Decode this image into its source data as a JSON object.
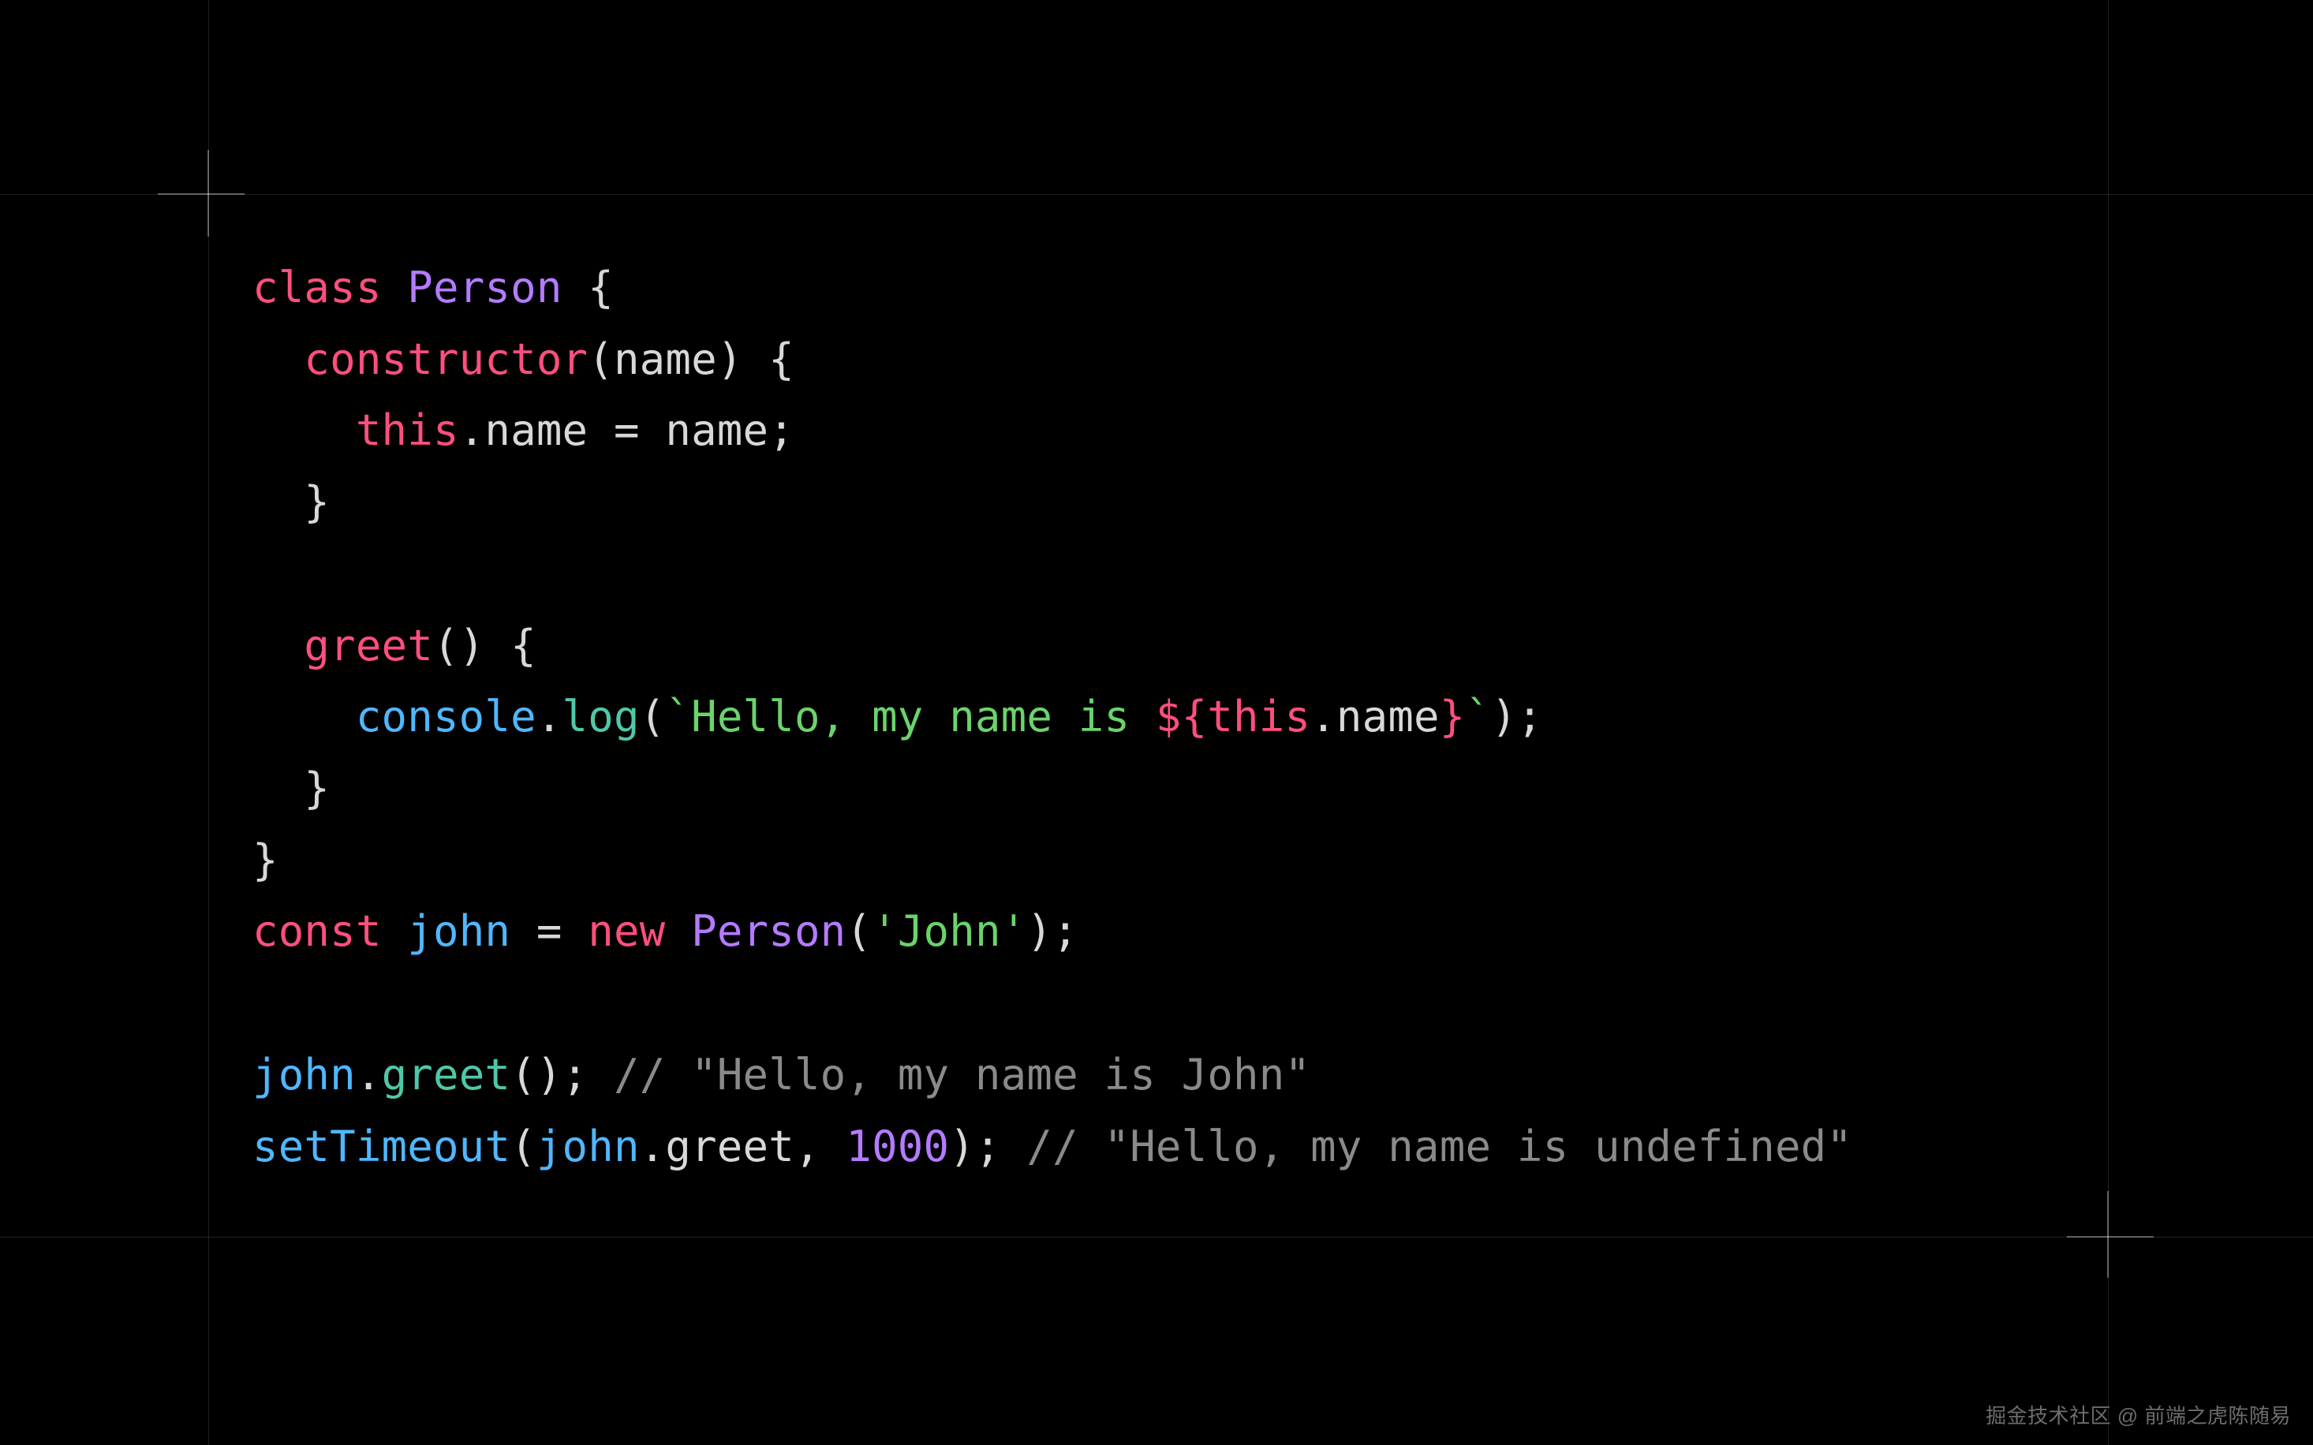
{
  "code": {
    "l1": {
      "kw_class": "class",
      "sp1": " ",
      "type_person": "Person",
      "sp2": " ",
      "brace_open": "{"
    },
    "l2": {
      "indent": "  ",
      "fn_constructor": "constructor",
      "paren_open": "(",
      "param_name": "name",
      "paren_close_brace": ") {"
    },
    "l3": {
      "indent": "    ",
      "kw_this": "this",
      "dot_name_eq": ".name = ",
      "rhs_name": "name",
      "semi": ";"
    },
    "l4": {
      "indent": "  ",
      "brace_close": "}"
    },
    "l5": {
      "blank": ""
    },
    "l6": {
      "indent": "  ",
      "fn_greet": "greet",
      "parens_brace": "() {"
    },
    "l7": {
      "indent": "    ",
      "ident_console": "console",
      "dot": ".",
      "method_log": "log",
      "paren_open": "(",
      "str_open": "`Hello, my name is ",
      "interp_open": "${",
      "kw_this": "this",
      "prop_name": ".name",
      "interp_close": "}",
      "str_close": "`",
      "paren_close_semi": ");"
    },
    "l8": {
      "indent": "  ",
      "brace_close": "}"
    },
    "l9": {
      "brace_close": "}"
    },
    "l10": {
      "kw_const": "const",
      "sp1": " ",
      "ident_john": "john",
      "eq": " = ",
      "kw_new": "new",
      "sp2": " ",
      "type_person": "Person",
      "paren_open": "(",
      "str_john": "'John'",
      "paren_close_semi": ");"
    },
    "l11": {
      "blank": ""
    },
    "l12": {
      "ident_john": "john",
      "dot": ".",
      "method_greet": "greet",
      "call_semi": "();",
      "sp": " ",
      "comment": "// \"Hello, my name is John\""
    },
    "l13": {
      "ident_settimeout": "setTimeout",
      "paren_open": "(",
      "ident_john": "john",
      "dot": ".",
      "prop_greet": "greet",
      "comma_sp": ", ",
      "num_1000": "1000",
      "paren_close_semi": ");",
      "sp": " ",
      "comment": "// \"Hello, my name is undefined\""
    }
  },
  "watermark": "掘金技术社区 @ 前端之虎陈随易"
}
